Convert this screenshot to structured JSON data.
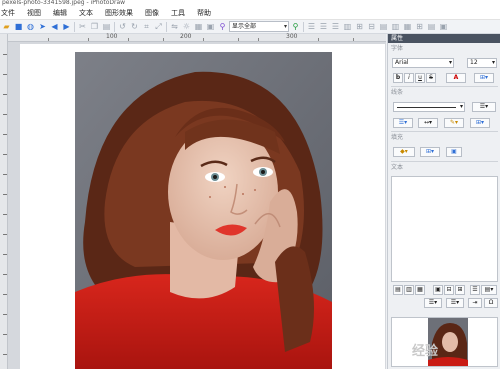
{
  "window": {
    "title": "pexels-photo-3341598.jpeg - iPhotoDraw"
  },
  "menu": [
    "文件",
    "视图",
    "编辑",
    "文本",
    "图形效果",
    "图像",
    "工具",
    "帮助"
  ],
  "toolbar": {
    "zoom_value": "显示全部"
  },
  "ruler": {
    "labels": [
      "100",
      "200",
      "300"
    ]
  },
  "panel": {
    "title": "属性",
    "sections": {
      "font": "字体",
      "line": "线条",
      "fill": "填充",
      "text": "文本"
    },
    "font_name": "Arial",
    "font_size": "12",
    "bold": "b",
    "italic": "i",
    "underline": "u",
    "strike": "S",
    "text_color": "A",
    "watermark": "经验"
  }
}
